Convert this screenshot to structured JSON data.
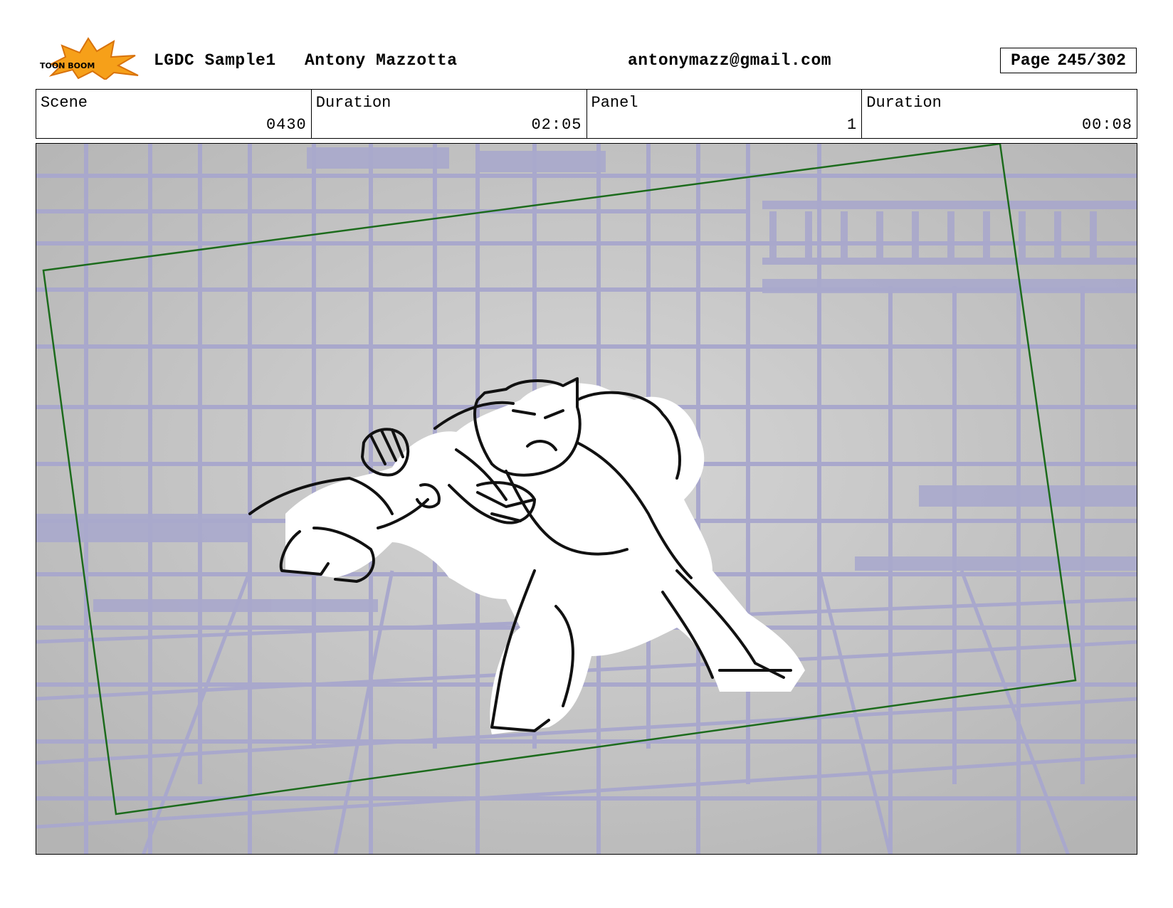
{
  "header": {
    "logo_text": "TOON BOOM",
    "project": "LGDC Sample1",
    "author": "Antony Mazzotta",
    "email": "antonymazz@gmail.com",
    "page_label": "Page",
    "page_value": "245/302"
  },
  "info": {
    "scene_label": "Scene",
    "scene_value": "0430",
    "scene_duration_label": "Duration",
    "scene_duration_value": "02:05",
    "panel_label": "Panel",
    "panel_value": "1",
    "panel_duration_label": "Duration",
    "panel_duration_value": "00:08"
  },
  "colors": {
    "background_lines": "#a9a8cc",
    "camera_frame": "#1c6b1c",
    "panel_bg": "#c9c9c9"
  }
}
